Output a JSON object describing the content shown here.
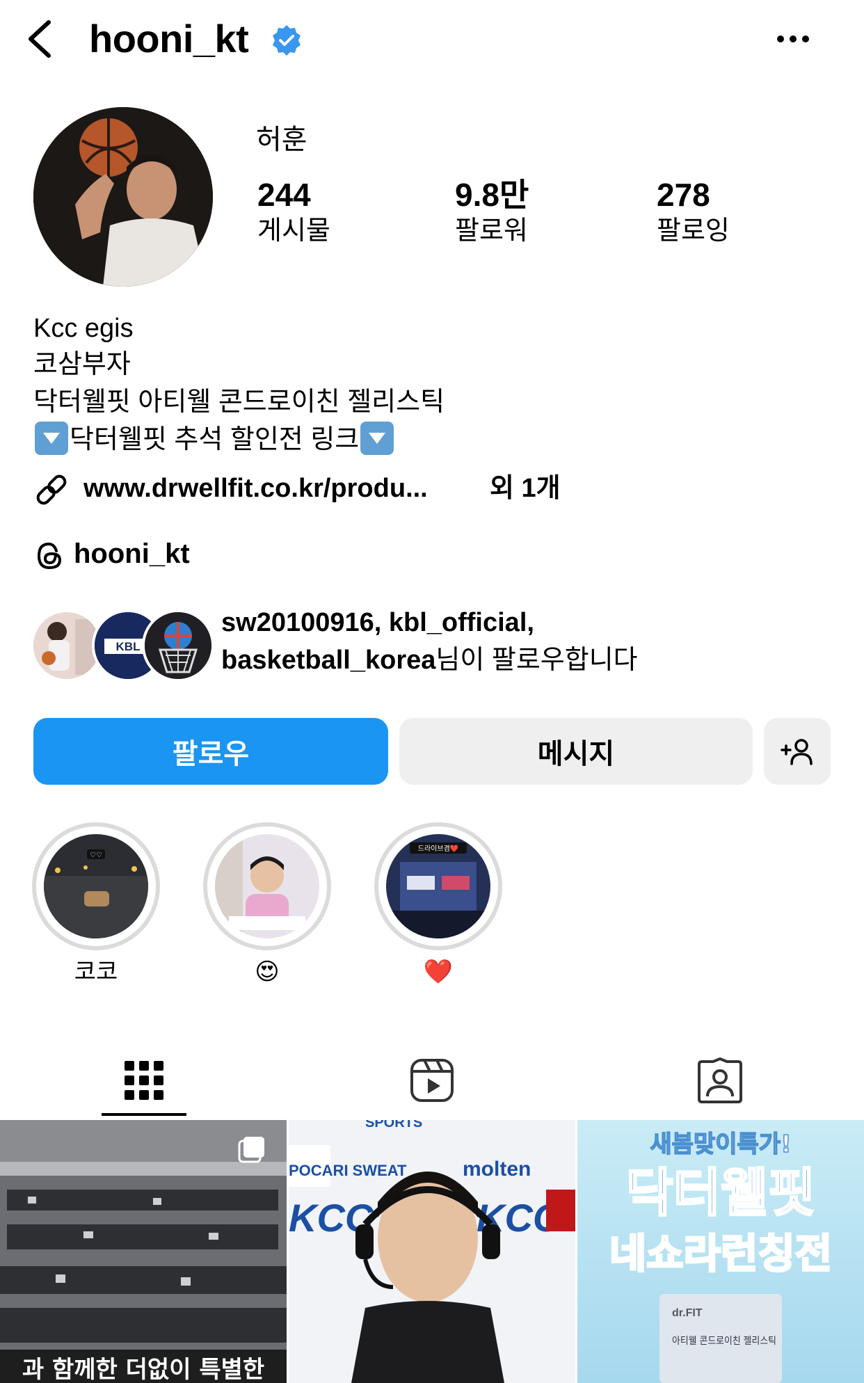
{
  "header": {
    "username": "hooni_kt",
    "verified": true
  },
  "profile": {
    "display_name": "허훈",
    "stats": [
      {
        "value": "244",
        "label": "게시물"
      },
      {
        "value": "9.8만",
        "label": "팔로워"
      },
      {
        "value": "278",
        "label": "팔로잉"
      }
    ],
    "bio_lines": [
      "Kcc egis",
      "코삼부자",
      "닥터웰핏 아티웰 콘드로이친 젤리스틱"
    ],
    "bio_promo_text": "닥터웰핏 추석 할인전 링크",
    "link": {
      "text": "www.drwellfit.co.kr/produ...",
      "extra": "외 1개"
    },
    "threads_handle": "hooni_kt",
    "mutual": {
      "names": "sw20100916, kbl_official,",
      "names_line2": "basketball_korea",
      "suffix": "님이 팔로우합니다"
    }
  },
  "actions": {
    "follow": "팔로우",
    "message": "메시지",
    "suggest_icon": "+person-icon"
  },
  "highlights": [
    {
      "label": "코코",
      "badge": "♡♡"
    },
    {
      "label": "😍",
      "badge": ""
    },
    {
      "label": "❤️",
      "badge": "드라이브겸❤️"
    }
  ],
  "tabs": [
    "grid-icon",
    "reels-icon",
    "tagged-icon"
  ],
  "posts": [
    {
      "caption": "과 함께한 더없이 특별한",
      "multi": true
    },
    {
      "sign_sports": "SPORTS",
      "sign_molten": "molten",
      "sign_kcc": "KCC",
      "sign_pocari": "POCARI SWEAT"
    },
    {
      "top": "새봄맞이특가!",
      "title1": "닥터웰핏",
      "title2": "네쇼라런칭전",
      "product": "아티웰 콘드로이친 젤리스틱",
      "brand": "dr.FIT"
    }
  ],
  "colors": {
    "accent": "#1a95f1",
    "verified": "#3897f0",
    "button_gray": "#efefef"
  }
}
